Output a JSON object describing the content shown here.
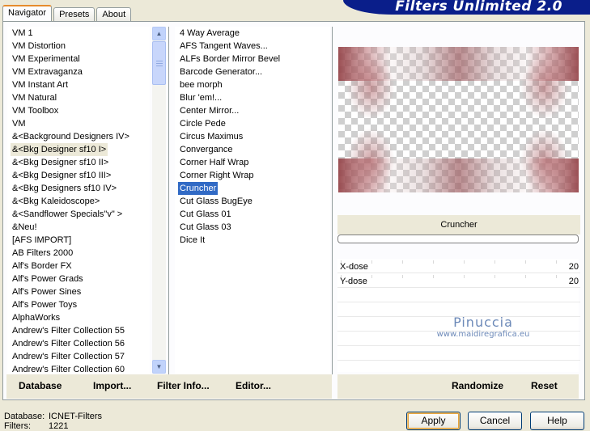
{
  "tabs": [
    "Navigator",
    "Presets",
    "About"
  ],
  "banner_title": "Filters Unlimited 2.0",
  "categories": [
    "VM 1",
    "VM Distortion",
    "VM Experimental",
    "VM Extravaganza",
    "VM Instant Art",
    "VM Natural",
    "VM Toolbox",
    "VM",
    "&<Background Designers IV>",
    "&<Bkg Designer sf10 I>",
    "&<Bkg Designer sf10 II>",
    "&<Bkg Designer sf10 III>",
    "&<Bkg Designers sf10 IV>",
    "&<Bkg Kaleidoscope>",
    "&<Sandflower Specials\"v\" >",
    "&Neu!",
    "[AFS IMPORT]",
    "AB Filters 2000",
    "Alf's Border FX",
    "Alf's Power Grads",
    "Alf's Power Sines",
    "Alf's Power Toys",
    "AlphaWorks",
    "Andrew's Filter Collection 55",
    "Andrew's Filter Collection 56",
    "Andrew's Filter Collection 57",
    "Andrew's Filter Collection 60"
  ],
  "selected_category": "&<Bkg Designer sf10 I>",
  "filters": [
    "4 Way Average",
    "AFS Tangent Waves...",
    "ALFs Border Mirror Bevel",
    "Barcode Generator...",
    "bee morph",
    "Blur 'em!...",
    "Center Mirror...",
    "Circle Pede",
    "Circus Maximus",
    "Convergance",
    "Corner Half Wrap",
    "Corner Right Wrap",
    "Cruncher",
    "Cut Glass  BugEye",
    "Cut Glass 01",
    "Cut Glass 03",
    "Dice It"
  ],
  "selected_filter": "Cruncher",
  "filter_title": "Cruncher",
  "params": [
    {
      "name": "X-dose",
      "value": "20"
    },
    {
      "name": "Y-dose",
      "value": "20"
    }
  ],
  "watermark": {
    "line1": "Pinuccia",
    "line2": "www.maidiregrafica.eu"
  },
  "bottom_left_buttons": [
    "Database",
    "Import...",
    "Filter Info...",
    "Editor..."
  ],
  "bottom_right_buttons": [
    "Randomize",
    "Reset"
  ],
  "status": {
    "database_label": "Database:",
    "database_value": "ICNET-Filters",
    "filters_label": "Filters:",
    "filters_value": "1221"
  },
  "dialog_buttons": {
    "apply": "Apply",
    "cancel": "Cancel",
    "help": "Help"
  },
  "colors": {
    "selection_blue": "#316ac5",
    "banner_blue": "#0a1e8a",
    "watermark": "#6c89b8"
  }
}
